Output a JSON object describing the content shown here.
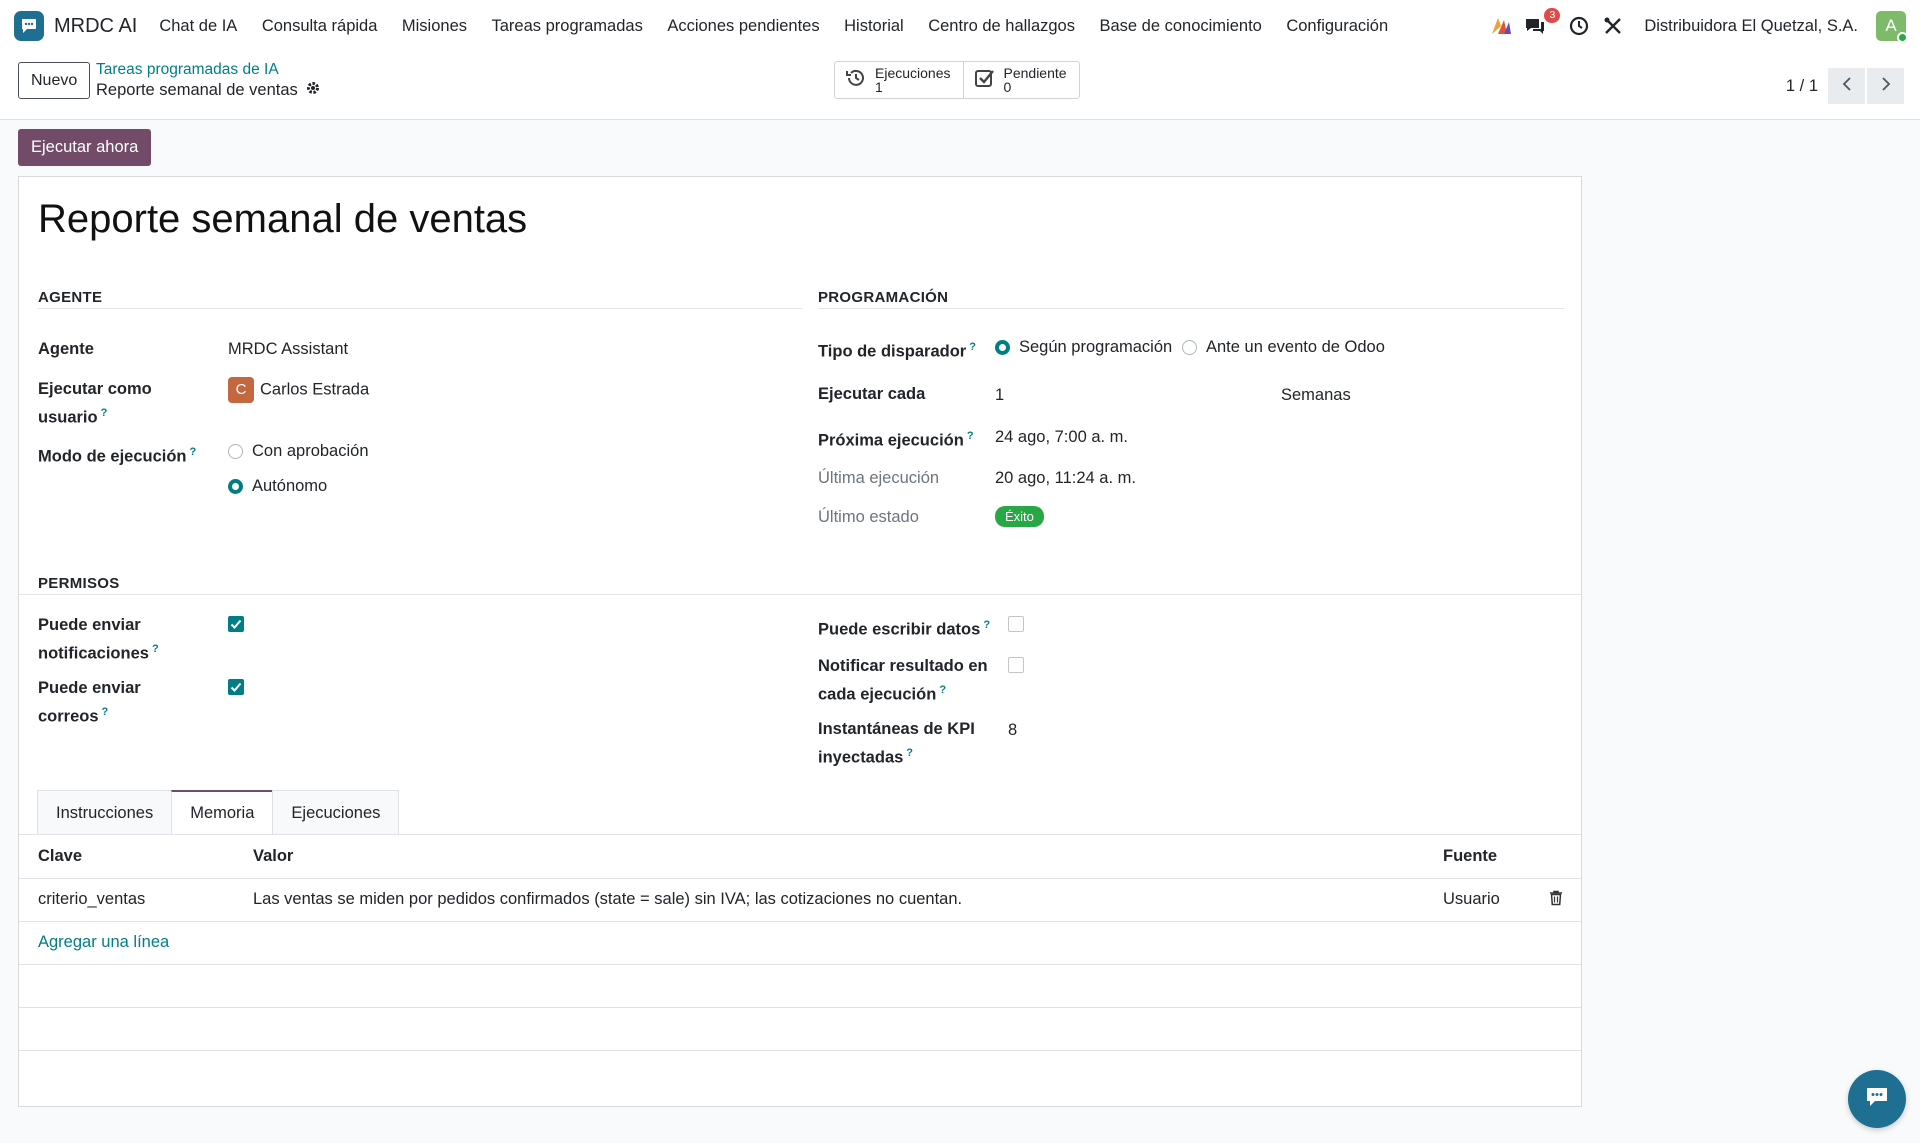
{
  "app": {
    "name": "MRDC AI"
  },
  "nav": {
    "items": [
      "Chat de IA",
      "Consulta rápida",
      "Misiones",
      "Tareas programadas",
      "Acciones pendientes",
      "Historial",
      "Centro de hallazgos",
      "Base de conocimiento",
      "Configuración"
    ],
    "messages_badge": "3",
    "company": "Distribuidora El Quetzal, S.A.",
    "avatar_initial": "A"
  },
  "control": {
    "new_label": "Nuevo",
    "breadcrumb_parent": "Tareas programadas de IA",
    "breadcrumb_current": "Reporte semanal de ventas",
    "smart_executions_label": "Ejecuciones",
    "smart_executions_count": "1",
    "smart_pending_label": "Pendiente",
    "smart_pending_count": "0",
    "pager": "1 / 1"
  },
  "actions": {
    "run_now": "Ejecutar ahora"
  },
  "record": {
    "title": "Reporte semanal de ventas",
    "agent_section": "AGENTE",
    "schedule_section": "PROGRAMACIÓN",
    "permissions_section": "PERMISOS",
    "agent_label": "Agente",
    "agent_value": "MRDC Assistant",
    "run_as_label_1": "Ejecutar como",
    "run_as_label_2": "usuario",
    "run_as_initial": "C",
    "run_as_value": "Carlos Estrada",
    "mode_label": "Modo de ejecución",
    "mode_options": [
      "Con aprobación",
      "Autónomo"
    ],
    "mode_selected": "Autónomo",
    "trigger_label": "Tipo de disparador",
    "trigger_options": [
      "Según programación",
      "Ante un evento de Odoo"
    ],
    "trigger_selected": "Según programación",
    "every_label": "Ejecutar cada",
    "every_value": "1",
    "every_unit": "Semanas",
    "next_label": "Próxima ejecución",
    "next_value": "24 ago, 7:00 a. m.",
    "last_label": "Última ejecución",
    "last_value": "20 ago, 11:24 a. m.",
    "last_state_label": "Último estado",
    "last_state_value": "Éxito",
    "can_notify_label_1": "Puede enviar",
    "can_notify_label_2": "notificaciones",
    "can_notify": true,
    "can_email_label_1": "Puede enviar",
    "can_email_label_2": "correos",
    "can_email": true,
    "can_write_label": "Puede escribir datos",
    "can_write": false,
    "notify_each_label_1": "Notificar resultado en",
    "notify_each_label_2": "cada ejecución",
    "notify_each": false,
    "kpi_label_1": "Instantáneas de KPI",
    "kpi_label_2": "inyectadas",
    "kpi_value": "8",
    "help_mark": "?"
  },
  "tabs": [
    "Instrucciones",
    "Memoria",
    "Ejecuciones"
  ],
  "active_tab": "Memoria",
  "memory": {
    "columns": [
      "Clave",
      "Valor",
      "Fuente"
    ],
    "rows": [
      {
        "key": "criterio_ventas",
        "value": "Las ventas se miden por pedidos confirmados (state = sale) sin IVA; las cotizaciones no cuentan.",
        "source": "Usuario"
      }
    ],
    "add_line": "Agregar una línea"
  },
  "colors": {
    "primary": "#714b67",
    "accent": "#017e84",
    "success": "#28a745",
    "logo": "#1f6f93"
  }
}
